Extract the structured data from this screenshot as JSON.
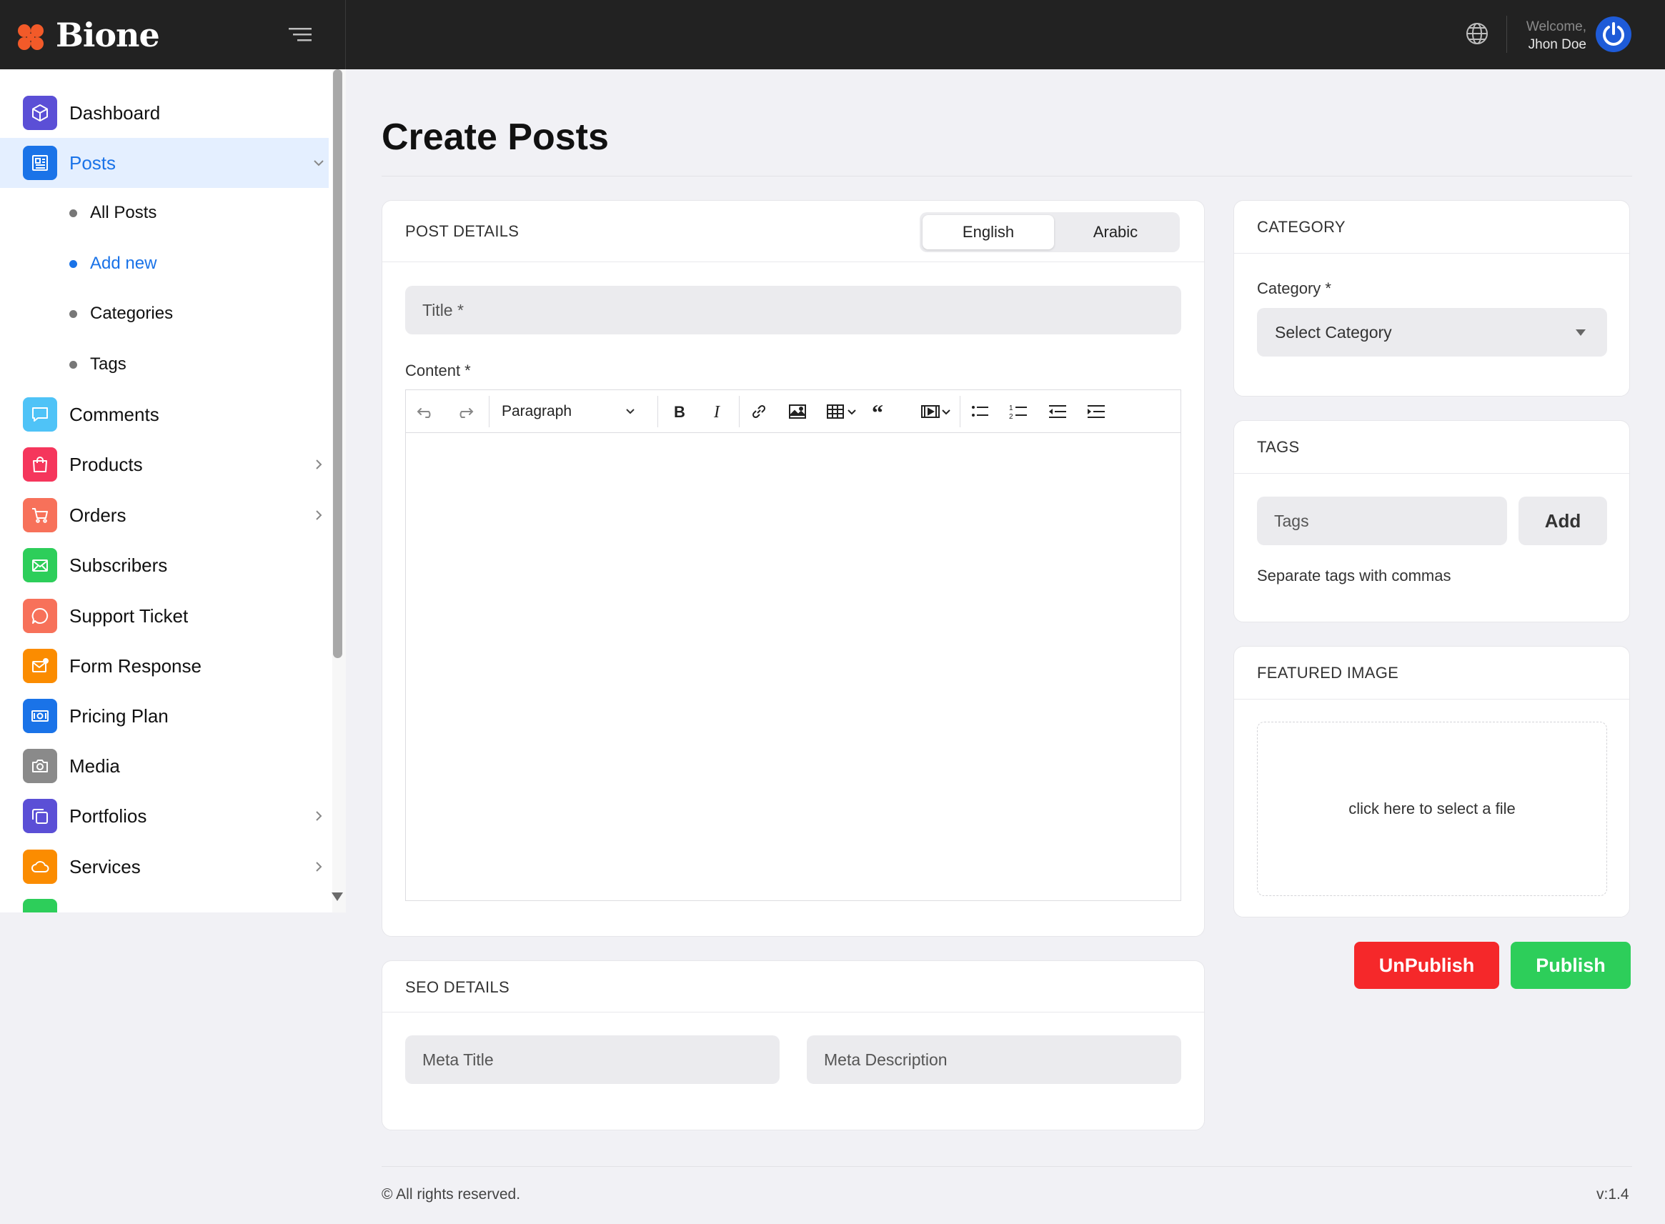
{
  "brand": {
    "name": "Bione"
  },
  "header": {
    "welcome": "Welcome,",
    "user_name": "Jhon Doe"
  },
  "sidebar": {
    "items": [
      {
        "label": "Dashboard",
        "icon": "cube-icon",
        "color": "#5b4fd6"
      },
      {
        "label": "Posts",
        "icon": "newspaper-icon",
        "color": "#1a73e8",
        "active": true
      },
      {
        "label": "Comments",
        "icon": "chat-icon",
        "color": "#4fc3f7"
      },
      {
        "label": "Products",
        "icon": "shopping-bag-icon",
        "color": "#f5365c"
      },
      {
        "label": "Orders",
        "icon": "cart-icon",
        "color": "#f7715a"
      },
      {
        "label": "Subscribers",
        "icon": "envelope-open-icon",
        "color": "#2dce5a"
      },
      {
        "label": "Support Ticket",
        "icon": "support-chat-icon",
        "color": "#f7715a"
      },
      {
        "label": "Form Response",
        "icon": "mail-notification-icon",
        "color": "#fb8c00"
      },
      {
        "label": "Pricing Plan",
        "icon": "money-icon",
        "color": "#1a73e8"
      },
      {
        "label": "Media",
        "icon": "camera-icon",
        "color": "#8a8a8a"
      },
      {
        "label": "Portfolios",
        "icon": "copy-icon",
        "color": "#5b4fd6"
      },
      {
        "label": "Services",
        "icon": "cloud-icon",
        "color": "#fb8c00"
      }
    ],
    "sub_items": [
      {
        "label": "All Posts"
      },
      {
        "label": "Add new",
        "current": true
      },
      {
        "label": "Categories"
      },
      {
        "label": "Tags"
      }
    ]
  },
  "page": {
    "title": "Create Posts"
  },
  "post_details": {
    "heading": "POST DETAILS",
    "languages": [
      "English",
      "Arabic"
    ],
    "title_placeholder": "Title *",
    "content_label": "Content *",
    "paragraph_style": "Paragraph"
  },
  "seo": {
    "heading": "SEO DETAILS",
    "meta_title_placeholder": "Meta Title",
    "meta_description_placeholder": "Meta Description"
  },
  "category": {
    "heading": "CATEGORY",
    "label": "Category *",
    "select_value": "Select Category"
  },
  "tags": {
    "heading": "TAGS",
    "placeholder": "Tags",
    "add_label": "Add",
    "help": "Separate tags with commas"
  },
  "featured_image": {
    "heading": "FEATURED IMAGE",
    "dropzone_text": "click here to select a file"
  },
  "actions": {
    "unpublish": "UnPublish",
    "publish": "Publish",
    "unpublish_color": "#f5282a",
    "publish_color": "#2dce5a"
  },
  "footer": {
    "copyright": "© All rights reserved.",
    "version": "v:1.4"
  }
}
